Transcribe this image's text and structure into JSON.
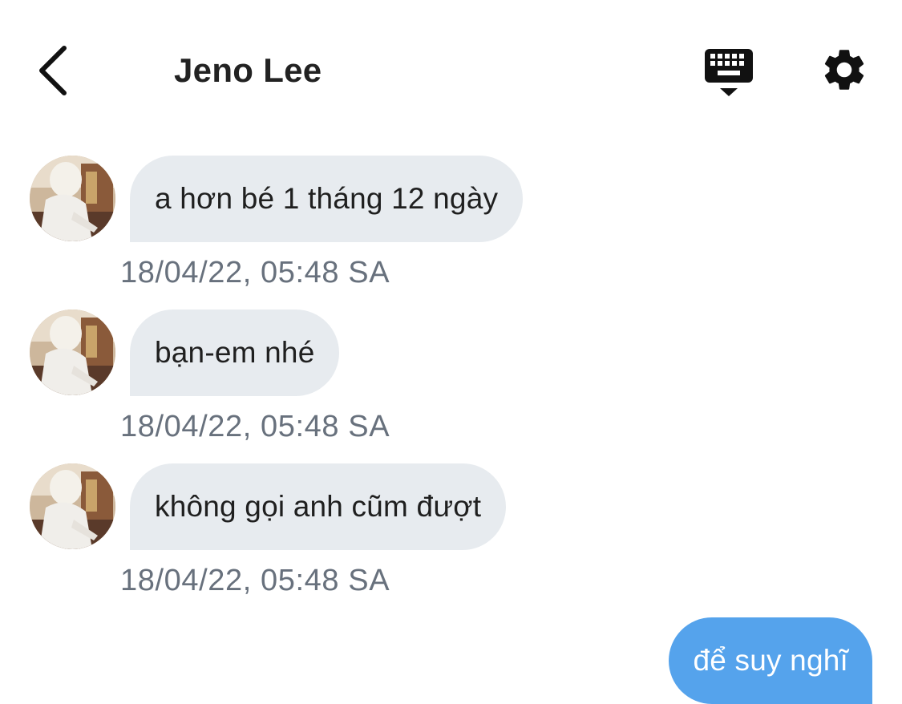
{
  "header": {
    "title": "Jeno Lee",
    "back_icon": "chevron-left-icon",
    "keyboard_icon": "keyboard-hide-icon",
    "settings_icon": "gear-icon"
  },
  "messages": [
    {
      "direction": "incoming",
      "text": "a hơn bé 1 tháng 12 ngày",
      "time": "18/04/22, 05:48 SA"
    },
    {
      "direction": "incoming",
      "text": "bạn-em nhé",
      "time": "18/04/22, 05:48 SA"
    },
    {
      "direction": "incoming",
      "text": "không gọi anh cũm đượt",
      "time": "18/04/22, 05:48 SA"
    },
    {
      "direction": "outgoing",
      "text": "để suy nghĩ"
    }
  ],
  "colors": {
    "incoming_bubble": "#e7ebef",
    "outgoing_bubble": "#55a3ec",
    "timestamp": "#68717d",
    "title": "#222222"
  }
}
